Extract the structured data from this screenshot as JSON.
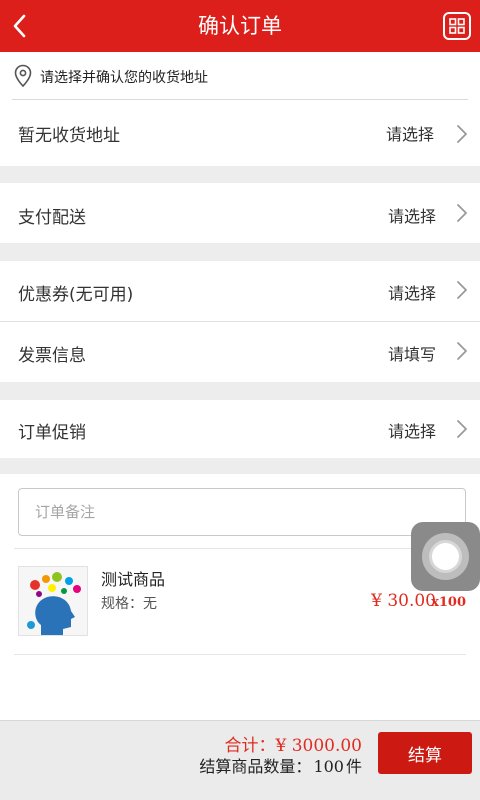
{
  "header": {
    "title": "确认订单",
    "back_icon": "chevron-left-icon",
    "menu_icon": "grid-menu-icon"
  },
  "address": {
    "hint": "请选择并确认您的收货地址",
    "none_label": "暂无收货地址",
    "action": "请选择"
  },
  "rows": {
    "payment": {
      "label": "支付配送",
      "value": "请选择"
    },
    "coupon": {
      "label": "优惠券(无可用)",
      "value": "请选择"
    },
    "invoice": {
      "label": "发票信息",
      "value": "请填写"
    },
    "promotion": {
      "label": "订单促销",
      "value": "请选择"
    }
  },
  "remark": {
    "placeholder": "订单备注",
    "value": ""
  },
  "product": {
    "name": "测试商品",
    "spec": "规格：无",
    "price": "¥ 30.00",
    "qty": "x100"
  },
  "footer": {
    "total_label": "合计：",
    "total_value": "¥ 3000.00",
    "count_label": "结算商品数量：",
    "count_value": "100",
    "count_unit": "件",
    "checkout_label": "结算"
  },
  "colors": {
    "brand_red": "#dc1f1a",
    "price_red": "#e02b20",
    "background": "#ededed"
  }
}
